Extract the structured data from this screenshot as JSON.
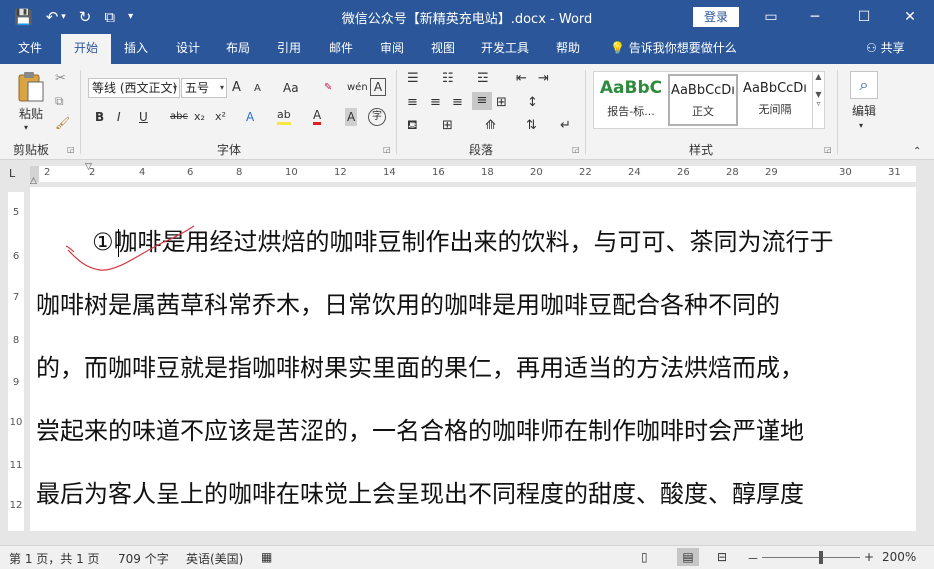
{
  "titlebar": {
    "title": "微信公众号【新精英充电站】.docx - Word",
    "login": "登录",
    "qat": {
      "save": "💾",
      "undo": "↶",
      "undo_dd": "▾",
      "redo": "↻",
      "touch": "⧉",
      "customize": "▾"
    },
    "controls": {
      "ribbon_display": "▭",
      "minimize": "─",
      "maximize": "☐",
      "close": "✕"
    }
  },
  "tabs": [
    "文件",
    "开始",
    "插入",
    "设计",
    "布局",
    "引用",
    "邮件",
    "审阅",
    "视图",
    "开发工具",
    "帮助"
  ],
  "active_tab": "开始",
  "tellme": "💡  告诉我你想要做什么",
  "share": "⚇ 共享",
  "ribbon": {
    "clipboard": {
      "label": "剪贴板",
      "paste": "粘贴"
    },
    "font": {
      "label": "字体",
      "font_name": "等线 (西文正文)",
      "font_size": "五号",
      "grow": "A",
      "shrink": "A",
      "case": "Aa",
      "phonetic": "wén",
      "border_char": "A",
      "bold": "B",
      "italic": "I",
      "underline": "U",
      "strike": "abc",
      "sub": "x₂",
      "sup": "x²",
      "text_effect": "A",
      "highlight": "ab",
      "font_color": "A",
      "shading": "A",
      "enclose": "字"
    },
    "paragraph": {
      "label": "段落"
    },
    "styles": {
      "label": "样式",
      "items": [
        {
          "preview": "AaBbC",
          "name": "报告-标..."
        },
        {
          "preview": "AaBbCcDı",
          "name": "正文"
        },
        {
          "preview": "AaBbCcDı",
          "name": "无间隔"
        }
      ]
    },
    "editing": {
      "label": "编辑",
      "icon": "⌕"
    }
  },
  "ruler": {
    "h_numbers": [
      "2",
      "2",
      "4",
      "6",
      "8",
      "10",
      "12",
      "14",
      "16",
      "18",
      "20",
      "22",
      "24",
      "26",
      "28",
      "29",
      "30",
      "31"
    ],
    "v_numbers": [
      "5",
      "6",
      "7",
      "8",
      "9",
      "10",
      "11",
      "12"
    ],
    "tab_selector": "L"
  },
  "document": {
    "paragraphs": [
      "①咖啡是用经过烘焙的咖啡豆制作出来的饮料，与可可、茶同为流行于",
      "咖啡树是属茜草科常乔木，日常饮用的咖啡是用咖啡豆配合各种不同的",
      "的，而咖啡豆就是指咖啡树果实里面的果仁，再用适当的方法烘焙而成，",
      "尝起来的味道不应该是苦涩的，一名合格的咖啡师在制作咖啡时会严谨地",
      "最后为客人呈上的咖啡在味觉上会呈现出不同程度的甜度、酸度、醇厚度"
    ]
  },
  "statusbar": {
    "page": "第 1 页，共 1 页",
    "words": "709 个字",
    "language": "英语(美国)",
    "zoom": "200%",
    "minus": "－",
    "plus": "+"
  },
  "colors": {
    "titlebar": "#2b579a",
    "ribbon": "#f3f3f3",
    "style_accent": "#2e8b3e",
    "ink_annotation": "#d9363e"
  }
}
